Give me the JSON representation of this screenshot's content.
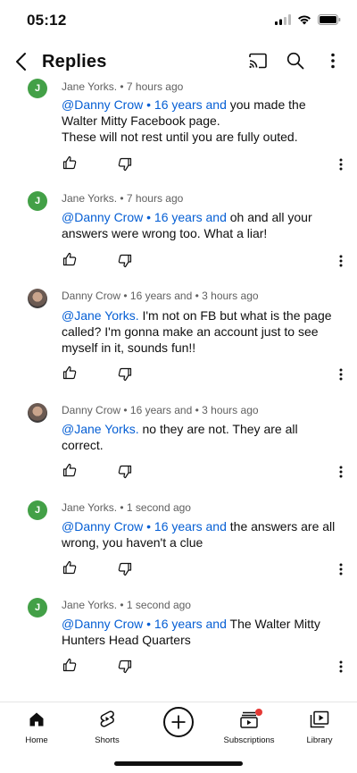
{
  "status": {
    "time": "05:12"
  },
  "header": {
    "title": "Replies"
  },
  "comments": [
    {
      "author": "Jane Yorks.",
      "age": "7 hours ago",
      "avatar_letter": "J",
      "mention": "@Danny Crow • 16 years and",
      "text_lines": [
        " you made the",
        "Walter Mitty Facebook page.",
        "These will not rest until you are fully outed."
      ]
    },
    {
      "author": "Jane Yorks.",
      "age": "7 hours ago",
      "avatar_letter": "J",
      "mention": "@Danny Crow • 16 years and",
      "text_lines": " oh and all your",
      "text_line2": "answers were wrong too. What a liar!"
    },
    {
      "author": "Danny Crow • 16 years and",
      "age": "3 hours ago",
      "mention": "@Jane Yorks.",
      "text_lines": "  I'm not on FB but what is the page",
      "text_line2": "called? I'm gonna make an account just to see",
      "text_line3": "myself in it, sounds fun!!"
    },
    {
      "author": "Danny Crow • 16 years and",
      "age": "3 hours ago",
      "mention": "@Jane Yorks.",
      "text_lines": "  no they are not. They are all",
      "text_line2": "correct."
    },
    {
      "author": "Jane Yorks.",
      "age": "1 second ago",
      "avatar_letter": "J",
      "mention": "@Danny Crow • 16 years and",
      "text_lines": "  the answers are all",
      "text_line2": "wrong, you haven't a clue"
    },
    {
      "author": "Jane Yorks.",
      "age": "1 second ago",
      "avatar_letter": "J",
      "mention": "@Danny Crow • 16 years and",
      "text_lines": " The Walter Mitty",
      "text_line2": "Hunters Head Quarters"
    }
  ],
  "bottom_nav": {
    "home": "Home",
    "shorts": "Shorts",
    "subscriptions": "Subscriptions",
    "library": "Library"
  },
  "colors": {
    "mention": "#065fd4",
    "avatar_green": "#43a047",
    "notification_dot": "#e53935"
  },
  "icons": [
    "cast-icon",
    "search-icon",
    "more-vert-icon",
    "like-icon",
    "dislike-icon",
    "home-icon",
    "shorts-icon",
    "create-icon",
    "subscriptions-icon",
    "library-icon"
  ]
}
